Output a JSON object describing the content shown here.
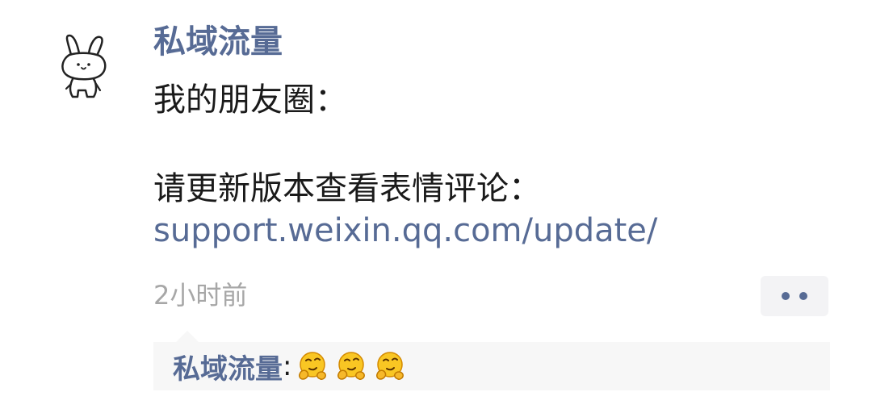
{
  "post": {
    "author": "私域流量",
    "content_line1": "我的朋友圈：",
    "content_line2": "请更新版本查看表情评论：",
    "link": "support.weixin.qq.com/update/",
    "timestamp": "2小时前"
  },
  "avatar": {
    "icon": "bunny-avatar-icon"
  },
  "more_button": {
    "icon": "more-dots-icon",
    "color": "#576b95"
  },
  "comment": {
    "author": "私域流量",
    "separator": ":",
    "emojis": [
      "thinking-hug-emoji",
      "thinking-hug-emoji",
      "thinking-hug-emoji"
    ]
  },
  "colors": {
    "name_blue": "#576b95",
    "text": "#1a1a1a",
    "time_gray": "#a7a7a7",
    "comment_bg": "#f7f7f7"
  }
}
